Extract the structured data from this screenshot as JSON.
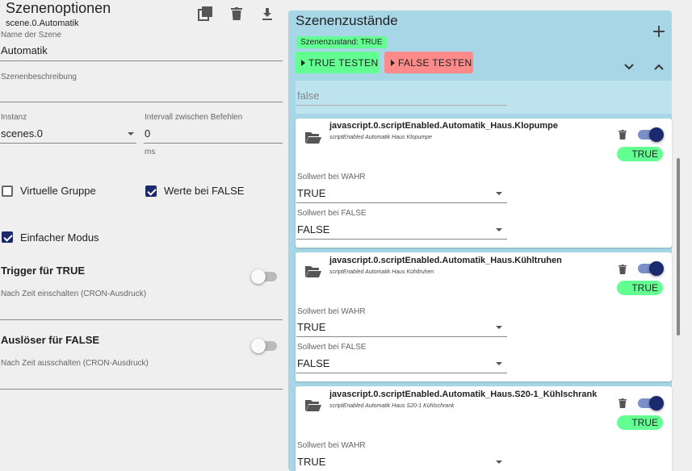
{
  "left": {
    "title": "Szenenoptionen",
    "id": "scene.0.Automatik",
    "name_label": "Name der Szene",
    "name_value": "Automatik",
    "desc_label": "Szenenbeschreibung",
    "desc_value": "",
    "instance_label": "Instanz",
    "instance_value": "scenes.0",
    "interval_label": "Intervall zwischen Befehlen",
    "interval_value": "0",
    "interval_unit": "ms",
    "virtual_group_label": "Virtuelle Gruppe",
    "values_false_label": "Werte bei FALSE",
    "simple_mode_label": "Einfacher Modus",
    "trigger_true_title": "Trigger für TRUE",
    "trigger_true_cron": "Nach Zeit einschalten (CRON-Ausdruck)",
    "trigger_false_title": "Auslöser für FALSE",
    "trigger_false_cron": "Nach Zeit ausschalten (CRON-Ausdruck)"
  },
  "right": {
    "title": "Szenenzustände",
    "state_badge": "Szenenzustand: TRUE",
    "test_true": "TRUE TESTEN",
    "test_false": "FALSE TESTEN",
    "false_input": "false",
    "cards": [
      {
        "title": "javascript.0.scriptEnabled.Automatik_Haus.Klopumpe",
        "subtitle": "scriptEnabled Automatik Haus Klopumpe",
        "state": "TRUE",
        "true_label": "Sollwert bei WAHR",
        "true_value": "TRUE",
        "false_label": "Sollwert bei FALSE",
        "false_value": "FALSE"
      },
      {
        "title": "javascript.0.scriptEnabled.Automatik_Haus.Kühltruhen",
        "subtitle": "scriptEnabled Automatik Haus Kühltruhen",
        "state": "TRUE",
        "true_label": "Sollwert bei WAHR",
        "true_value": "TRUE",
        "false_label": "Sollwert bei FALSE",
        "false_value": "FALSE"
      },
      {
        "title": "javascript.0.scriptEnabled.Automatik_Haus.S20-1_Kühlschrank",
        "subtitle": "scriptEnabled Automatik Haus S20-1 Kühlschrank",
        "state": "TRUE",
        "true_label": "Sollwert bei WAHR",
        "true_value": "TRUE"
      }
    ]
  },
  "colors": {
    "accent": "#1a2a6c",
    "green": "#64ff93",
    "red": "#ff8a8a",
    "panel": "#a7d7e6"
  }
}
